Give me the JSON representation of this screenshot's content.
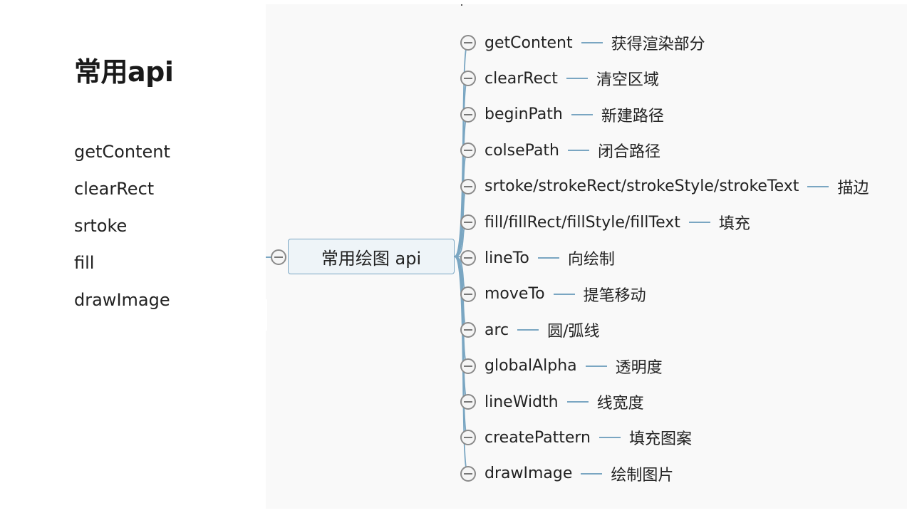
{
  "slide": {
    "title": "常用api",
    "bullets": [
      "getContent",
      "clearRect",
      "srtoke",
      "fill",
      "drawImage"
    ]
  },
  "mindmap": {
    "root": "常用绘图 api",
    "line_color": "#7aa6c2",
    "branches": [
      {
        "name": "getContent",
        "desc": "获得渲染部分"
      },
      {
        "name": "clearRect",
        "desc": "清空区域"
      },
      {
        "name": "beginPath",
        "desc": "新建路径"
      },
      {
        "name": "colsePath",
        "desc": "闭合路径"
      },
      {
        "name": "srtoke/strokeRect/strokeStyle/strokeText",
        "desc": "描边"
      },
      {
        "name": "fill/fillRect/fillStyle/fillText",
        "desc": "填充"
      },
      {
        "name": "lineTo",
        "desc": "向绘制"
      },
      {
        "name": "moveTo",
        "desc": "提笔移动"
      },
      {
        "name": "arc",
        "desc": "圆/弧线"
      },
      {
        "name": "globalAlpha",
        "desc": "透明度"
      },
      {
        "name": "lineWidth",
        "desc": "线宽度"
      },
      {
        "name": "createPattern",
        "desc": "填充图案"
      },
      {
        "name": "drawImage",
        "desc": "绘制图片"
      }
    ]
  }
}
